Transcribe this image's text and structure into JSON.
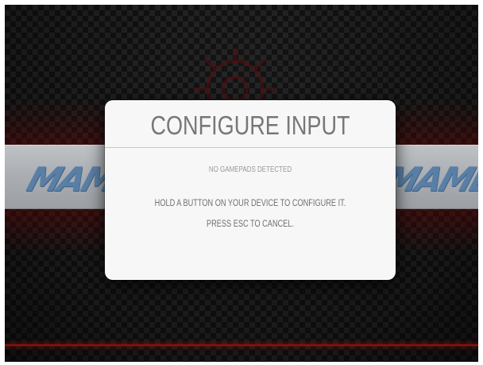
{
  "dialog": {
    "title": "CONFIGURE INPUT",
    "status": "NO GAMEPADS DETECTED",
    "instruction": "HOLD A BUTTON ON YOUR DEVICE TO CONFIGURE IT.",
    "cancel_hint": "PRESS ESC TO CANCEL."
  },
  "banner": {
    "logo_left": "MAME",
    "logo_right": "MAME"
  },
  "colors": {
    "dialog_background": "#f7f7f7",
    "title_text": "#777777",
    "body_text": "#6f6f6f",
    "banner": "#b2b5b8",
    "logo": "#5a7fa6",
    "accent_red": "#8a1010",
    "carbon_dark": "#141414",
    "carbon_light": "#262626"
  },
  "icons": {
    "gear": "gear-icon"
  }
}
